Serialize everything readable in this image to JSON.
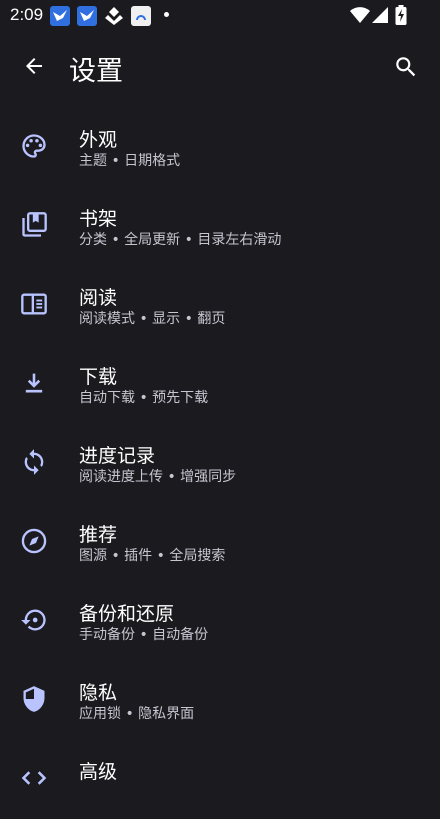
{
  "status_bar": {
    "time": "2:09"
  },
  "app_bar": {
    "title": "设置"
  },
  "settings": [
    {
      "icon": "palette-icon",
      "title": "外观",
      "subtitle": "主题 • 日期格式"
    },
    {
      "icon": "library-icon",
      "title": "书架",
      "subtitle": "分类 • 全局更新 • 目录左右滑动"
    },
    {
      "icon": "reader-icon",
      "title": "阅读",
      "subtitle": "阅读模式 • 显示 • 翻页"
    },
    {
      "icon": "download-icon",
      "title": "下载",
      "subtitle": "自动下载 • 预先下载"
    },
    {
      "icon": "sync-icon",
      "title": "进度记录",
      "subtitle": "阅读进度上传 • 增强同步"
    },
    {
      "icon": "compass-icon",
      "title": "推荐",
      "subtitle": "图源 • 插件 • 全局搜索"
    },
    {
      "icon": "restore-icon",
      "title": "备份和还原",
      "subtitle": "手动备份 • 自动备份"
    },
    {
      "icon": "shield-icon",
      "title": "隐私",
      "subtitle": "应用锁 • 隐私界面"
    },
    {
      "icon": "code-icon",
      "title": "高级",
      "subtitle": ""
    }
  ],
  "colors": {
    "background": "#1b1b1f",
    "icon_accent": "#b9c3ff",
    "title_text": "#ffffff",
    "subtitle_text": "#c7c5d0"
  }
}
